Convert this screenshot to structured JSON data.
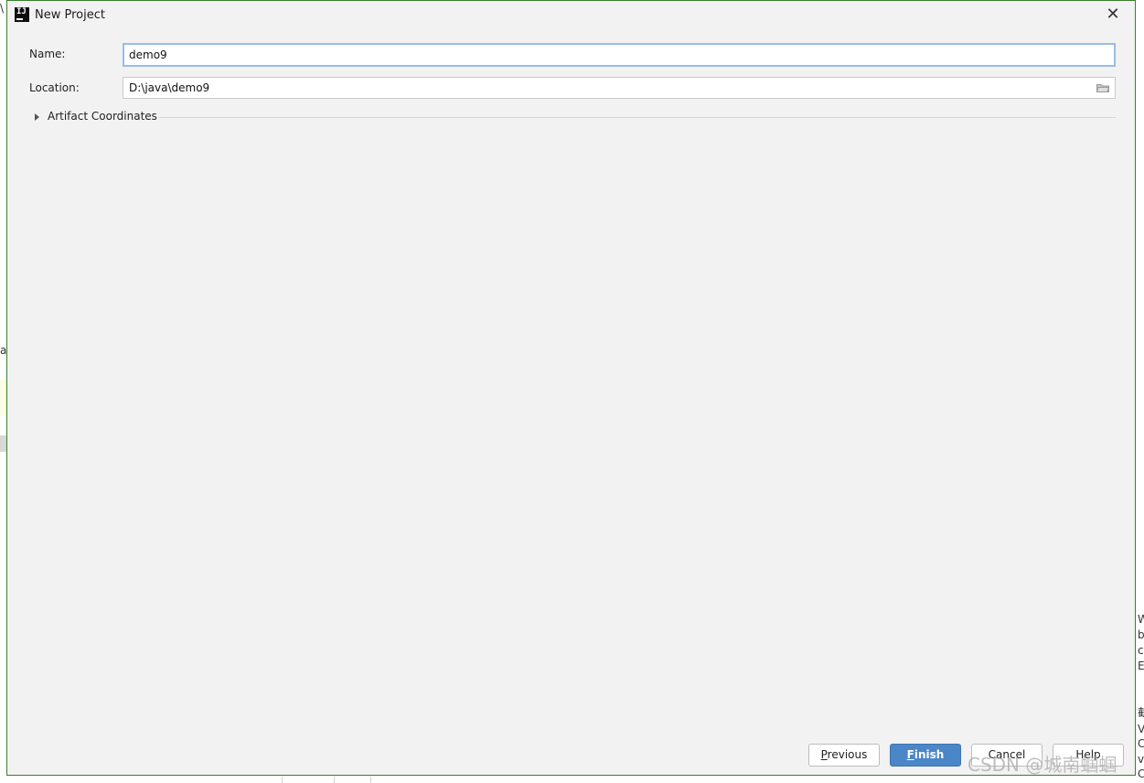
{
  "dialog": {
    "title": "New Project",
    "app_icon_text": "IJ",
    "close_glyph": "✕"
  },
  "form": {
    "name_label": "Name:",
    "name_value": "demo9",
    "location_label": "Location:",
    "location_value": "D:\\java\\demo9"
  },
  "artifact": {
    "label": "Artifact Coordinates"
  },
  "buttons": {
    "previous_pre": "",
    "previous_mn": "P",
    "previous_post": "revious",
    "finish_pre": "",
    "finish_mn": "F",
    "finish_post": "inish",
    "cancel": "Cancel",
    "help": "Help"
  },
  "background": {
    "left_glyphs": [
      "\\",
      "al"
    ],
    "right_glyphs": [
      "W",
      "b",
      "c",
      "E",
      "截",
      "V",
      "C",
      "v",
      "C"
    ]
  },
  "watermark": "CSDN @城南蝈蝈",
  "colors": {
    "dialog_bg": "#f2f2f2",
    "dialog_border": "#3c7d2e",
    "focus_border": "#98bde8",
    "primary_button": "#4a86c8"
  }
}
